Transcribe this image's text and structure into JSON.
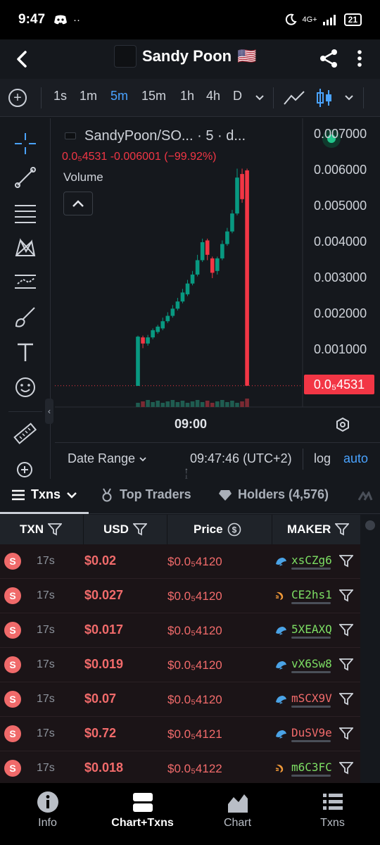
{
  "status": {
    "time": "9:47",
    "dots": "··",
    "network": "4G+",
    "battery": "21"
  },
  "header": {
    "title": "Sandy Poon",
    "flag": "🇺🇸"
  },
  "timeframes": {
    "items": [
      "1s",
      "1m",
      "5m",
      "15m",
      "1h",
      "4h",
      "D"
    ],
    "active": "5m"
  },
  "chart": {
    "symbol": "SandyPoon/SO... · 5 · d...",
    "ohlc": "0.0₅4531  -0.006001 (−99.92%)",
    "volume_label": "Volume",
    "y_ticks": [
      "0.007000",
      "0.006000",
      "0.005000",
      "0.004000",
      "0.003000",
      "0.002000",
      "0.001000"
    ],
    "last_price": "0.0₅4531",
    "x_tick": "09:00",
    "date_range": "Date Range",
    "clock": "09:47:46 (UTC+2)",
    "log": "log",
    "auto": "auto"
  },
  "chart_data": {
    "type": "candlestick",
    "title": "SandyPoon/SO... · 5 · d...",
    "ylim": [
      0,
      0.007
    ],
    "x_tick_labels": [
      "09:00"
    ],
    "candles": [
      {
        "o": 0.0,
        "c": 0.00137,
        "h": 0.0014,
        "l": 0.0
      },
      {
        "o": 0.00135,
        "c": 0.00118,
        "h": 0.0014,
        "l": 0.00105
      },
      {
        "o": 0.00118,
        "c": 0.00135,
        "h": 0.00142,
        "l": 0.00112
      },
      {
        "o": 0.00135,
        "c": 0.00155,
        "h": 0.0016,
        "l": 0.0013
      },
      {
        "o": 0.0015,
        "c": 0.00165,
        "h": 0.0017,
        "l": 0.00145
      },
      {
        "o": 0.0016,
        "c": 0.0018,
        "h": 0.0019,
        "l": 0.00155
      },
      {
        "o": 0.0018,
        "c": 0.00195,
        "h": 0.00205,
        "l": 0.00175
      },
      {
        "o": 0.00195,
        "c": 0.00215,
        "h": 0.00225,
        "l": 0.0019
      },
      {
        "o": 0.00215,
        "c": 0.00235,
        "h": 0.00245,
        "l": 0.0021
      },
      {
        "o": 0.00235,
        "c": 0.0026,
        "h": 0.0027,
        "l": 0.0023
      },
      {
        "o": 0.00255,
        "c": 0.00285,
        "h": 0.00295,
        "l": 0.0025
      },
      {
        "o": 0.00285,
        "c": 0.0031,
        "h": 0.0032,
        "l": 0.0028
      },
      {
        "o": 0.0031,
        "c": 0.0035,
        "h": 0.00365,
        "l": 0.00305
      },
      {
        "o": 0.0035,
        "c": 0.004,
        "h": 0.0041,
        "l": 0.00345
      },
      {
        "o": 0.00405,
        "c": 0.00365,
        "h": 0.0041,
        "l": 0.0035
      },
      {
        "o": 0.00355,
        "c": 0.00315,
        "h": 0.0036,
        "l": 0.003
      },
      {
        "o": 0.0032,
        "c": 0.00355,
        "h": 0.0036,
        "l": 0.0031
      },
      {
        "o": 0.00355,
        "c": 0.00395,
        "h": 0.00405,
        "l": 0.0035
      },
      {
        "o": 0.00395,
        "c": 0.0043,
        "h": 0.0044,
        "l": 0.0039
      },
      {
        "o": 0.0043,
        "c": 0.0048,
        "h": 0.0049,
        "l": 0.00425
      },
      {
        "o": 0.0048,
        "c": 0.0058,
        "h": 0.00605,
        "l": 0.00475
      },
      {
        "o": 0.0059,
        "c": 0.0052,
        "h": 0.00605,
        "l": 0.0051
      },
      {
        "o": 0.006,
        "c": 4.5e-06,
        "h": 0.00605,
        "l": 0.0
      }
    ]
  },
  "tabs": [
    {
      "label": "Txns",
      "active": true
    },
    {
      "label": "Top Traders",
      "active": false
    },
    {
      "label": "Holders (4,576)",
      "active": false
    }
  ],
  "table": {
    "columns": [
      "TXN",
      "USD",
      "Price",
      "MAKER"
    ],
    "rows": [
      {
        "side": "S",
        "age": "17s",
        "usd": "$0.02",
        "price": "$0.0₅4120",
        "maker": "xsCZg6",
        "maker_color": "#7ddf64",
        "icon": "fish"
      },
      {
        "side": "S",
        "age": "17s",
        "usd": "$0.027",
        "price": "$0.0₅4120",
        "maker": "CE2hs1",
        "maker_color": "#7ddf64",
        "icon": "shrimp"
      },
      {
        "side": "S",
        "age": "17s",
        "usd": "$0.017",
        "price": "$0.0₅4120",
        "maker": "5XEAXQ",
        "maker_color": "#7ddf64",
        "icon": "fish"
      },
      {
        "side": "S",
        "age": "17s",
        "usd": "$0.019",
        "price": "$0.0₅4120",
        "maker": "vX6Sw8",
        "maker_color": "#7ddf64",
        "icon": "fish"
      },
      {
        "side": "S",
        "age": "17s",
        "usd": "$0.07",
        "price": "$0.0₅4120",
        "maker": "mSCX9V",
        "maker_color": "#f26b6b",
        "icon": "fish"
      },
      {
        "side": "S",
        "age": "17s",
        "usd": "$0.72",
        "price": "$0.0₅4121",
        "maker": "DuSV9e",
        "maker_color": "#f26b6b",
        "icon": "fish"
      },
      {
        "side": "S",
        "age": "17s",
        "usd": "$0.018",
        "price": "$0.0₅4122",
        "maker": "m6C3FC",
        "maker_color": "#7ddf64",
        "icon": "shrimp"
      }
    ]
  },
  "bottom_nav": [
    {
      "label": "Info",
      "icon": "info-icon",
      "active": false
    },
    {
      "label": "Chart+Txns",
      "icon": "split-view-icon",
      "active": true
    },
    {
      "label": "Chart",
      "icon": "chart-icon",
      "active": false
    },
    {
      "label": "Txns",
      "icon": "list-icon",
      "active": false
    }
  ],
  "colors": {
    "up": "#089981",
    "down": "#f23645",
    "accent": "#4aa3ff"
  }
}
